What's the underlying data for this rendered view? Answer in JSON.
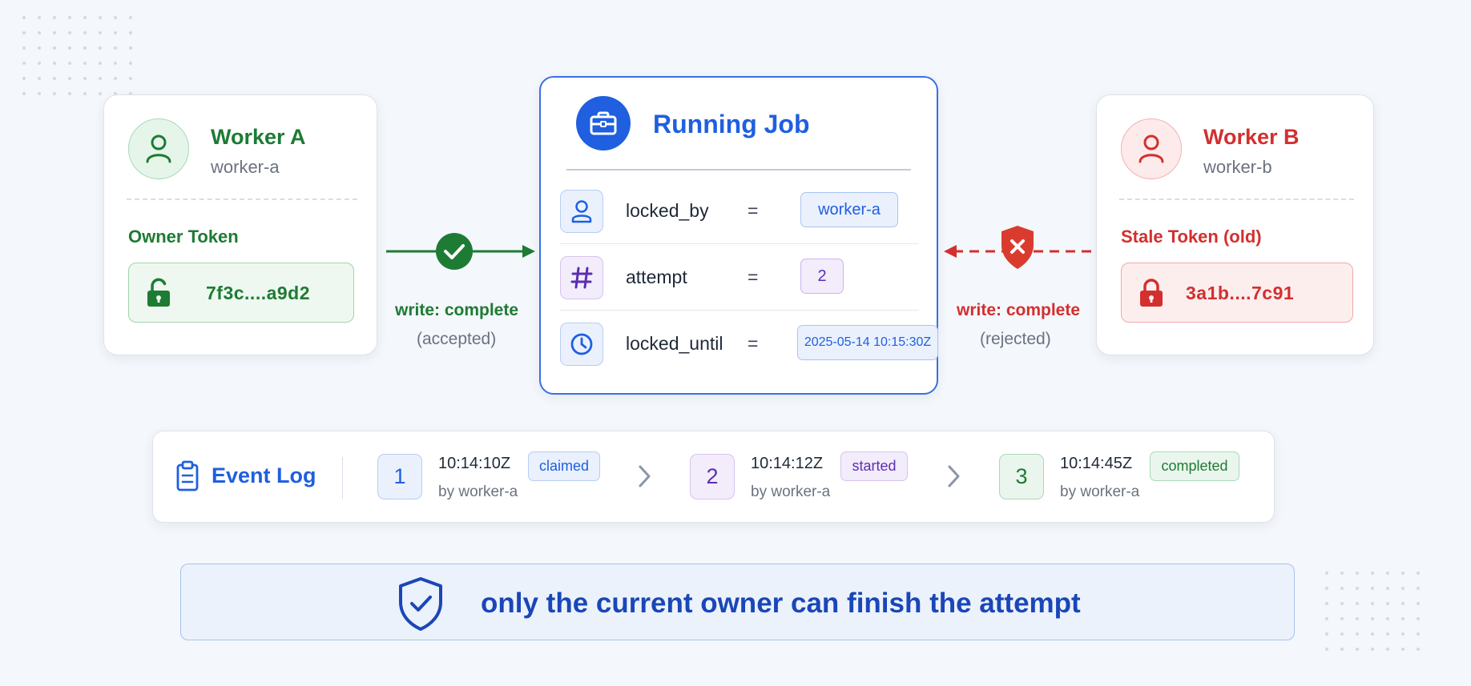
{
  "worker_a": {
    "name": "Worker A",
    "id": "worker-a",
    "token_label": "Owner Token",
    "token_value": "7f3c....a9d2",
    "icon": "user-icon",
    "lock_icon": "unlocked-icon",
    "color": "#1e7b34"
  },
  "worker_b": {
    "name": "Worker B",
    "id": "worker-b",
    "token_label": "Stale Token (old)",
    "token_value": "3a1b....7c91",
    "icon": "user-icon",
    "lock_icon": "locked-icon",
    "color": "#d32f2f"
  },
  "job": {
    "title": "Running Job",
    "icon": "briefcase-icon",
    "fields": [
      {
        "key": "locked_by",
        "eq": "=",
        "value": "worker-a",
        "icon": "user-icon"
      },
      {
        "key": "attempt",
        "eq": "=",
        "value": "2",
        "icon": "hash-icon"
      },
      {
        "key": "locked_until",
        "eq": "=",
        "value": "2025-05-14 10:15:30Z",
        "icon": "clock-icon"
      }
    ],
    "color": "#1f5fe0"
  },
  "arrows": {
    "left": {
      "label": "write: complete",
      "status": "(accepted)",
      "icon": "check-icon"
    },
    "right": {
      "label": "write: complete",
      "status": "(rejected)",
      "icon": "shield-x-icon"
    }
  },
  "event_log": {
    "title": "Event Log",
    "icon": "clipboard-icon",
    "events": [
      {
        "step": "1",
        "time": "10:14:10Z",
        "badge": "claimed",
        "by": "by worker-a"
      },
      {
        "step": "2",
        "time": "10:14:12Z",
        "badge": "started",
        "by": "by worker-a"
      },
      {
        "step": "3",
        "time": "10:14:45Z",
        "badge": "completed",
        "by": "by worker-a"
      }
    ]
  },
  "banner": {
    "text": "only the current owner can finish the attempt",
    "icon": "shield-check-icon"
  }
}
